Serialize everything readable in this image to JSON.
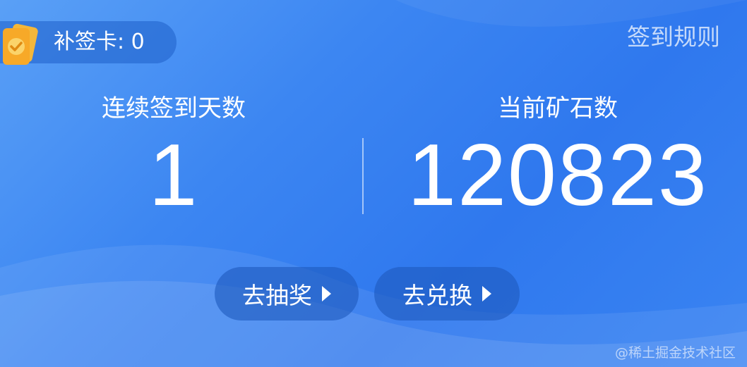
{
  "makeup_card": {
    "label": "补签卡: 0"
  },
  "rules_link": {
    "label": "签到规则"
  },
  "stats": {
    "streak": {
      "label": "连续签到天数",
      "value": "1"
    },
    "ore": {
      "label": "当前矿石数",
      "value": "120823"
    }
  },
  "actions": {
    "draw": {
      "label": "去抽奖",
      "icon": "triangle-right-icon"
    },
    "exchange": {
      "label": "去兑换",
      "icon": "triangle-right-icon"
    }
  },
  "watermark": {
    "text": "@稀土掘金技术社区"
  },
  "colors": {
    "background": "#3c86f2",
    "button_bg": "#1e5abe",
    "card_icon": "#f7a928"
  }
}
